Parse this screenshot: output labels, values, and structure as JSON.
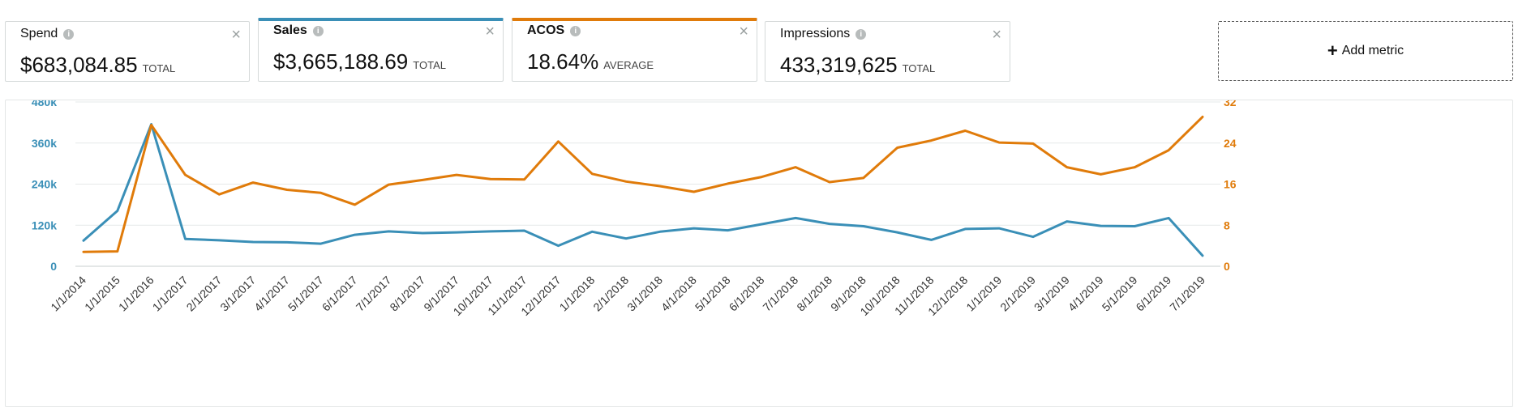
{
  "metrics": [
    {
      "name": "Spend",
      "value": "$683,084.85",
      "qualifier": "TOTAL",
      "selected": false
    },
    {
      "name": "Sales",
      "value": "$3,665,188.69",
      "qualifier": "TOTAL",
      "selected": true,
      "accent": "#3a8fb7"
    },
    {
      "name": "ACOS",
      "value": "18.64%",
      "qualifier": "AVERAGE",
      "selected": true,
      "accent": "#e07b0a"
    },
    {
      "name": "Impressions",
      "value": "433,319,625",
      "qualifier": "TOTAL",
      "selected": false
    }
  ],
  "add_metric_label": "Add metric",
  "icons": {
    "info": "info-icon",
    "close": "close-icon",
    "add": "plus-icon"
  },
  "colors": {
    "sales": "#3a8fb7",
    "acos": "#e07b0a",
    "grid": "#e6e9e9",
    "text": "#111111"
  },
  "chart_data": {
    "type": "line",
    "x": [
      "1/1/2014",
      "1/1/2015",
      "1/1/2016",
      "1/1/2017",
      "2/1/2017",
      "3/1/2017",
      "4/1/2017",
      "5/1/2017",
      "6/1/2017",
      "7/1/2017",
      "8/1/2017",
      "9/1/2017",
      "10/1/2017",
      "11/1/2017",
      "12/1/2017",
      "1/1/2018",
      "2/1/2018",
      "3/1/2018",
      "4/1/2018",
      "5/1/2018",
      "6/1/2018",
      "7/1/2018",
      "8/1/2018",
      "9/1/2018",
      "10/1/2018",
      "11/1/2018",
      "12/1/2018",
      "1/1/2019",
      "2/1/2019",
      "3/1/2019",
      "4/1/2019",
      "5/1/2019",
      "6/1/2019",
      "7/1/2019"
    ],
    "series": [
      {
        "name": "Sales",
        "axis": "left",
        "color": "#3a8fb7",
        "values": [
          75000,
          162000,
          415000,
          80000,
          76000,
          71000,
          70000,
          66000,
          92000,
          102000,
          97000,
          99000,
          102000,
          104000,
          60000,
          101000,
          81000,
          101000,
          111000,
          105000,
          123000,
          141000,
          124000,
          117000,
          99000,
          77000,
          109000,
          111000,
          86000,
          131000,
          118000,
          117000,
          141000,
          31000
        ]
      },
      {
        "name": "ACOS",
        "axis": "right",
        "color": "#e07b0a",
        "values": [
          2.8,
          2.9,
          27.5,
          17.8,
          14.0,
          16.3,
          14.9,
          14.3,
          12.0,
          15.9,
          16.8,
          17.8,
          17.0,
          16.9,
          24.3,
          18.0,
          16.5,
          15.6,
          14.5,
          16.1,
          17.4,
          19.3,
          16.4,
          17.2,
          23.1,
          24.5,
          26.4,
          24.1,
          23.9,
          19.3,
          17.9,
          19.3,
          22.6,
          29.1
        ]
      }
    ],
    "y_left": {
      "ticks": [
        "0",
        "120k",
        "240k",
        "360k",
        "480k"
      ],
      "ylim": [
        0,
        480000
      ]
    },
    "y_right": {
      "ticks": [
        "0",
        "8",
        "16",
        "24",
        "32"
      ],
      "ylim": [
        0,
        32
      ]
    },
    "grid": true
  }
}
